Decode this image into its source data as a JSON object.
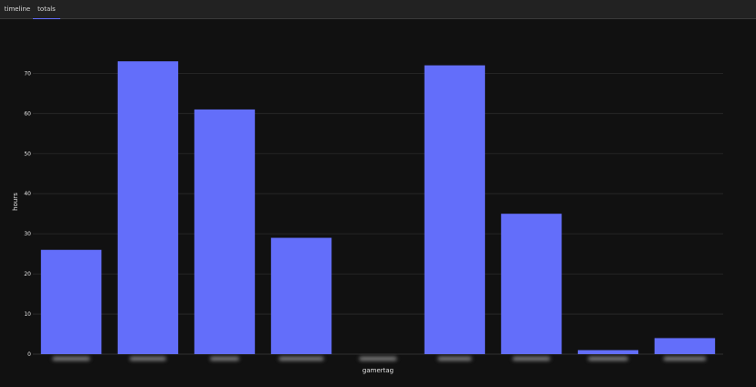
{
  "tabs": [
    {
      "label": "timeline",
      "active": false
    },
    {
      "label": "totals",
      "active": true
    }
  ],
  "colors": {
    "bar": "#636efa",
    "grid": "#2b2b2b",
    "background": "#111111",
    "tab_active_underline": "#636efa"
  },
  "chart_data": {
    "type": "bar",
    "title": "",
    "xlabel": "gamertag",
    "ylabel": "hours",
    "categories_obscured": true,
    "values": [
      26,
      73,
      61,
      29,
      0,
      72,
      35,
      1,
      4
    ],
    "ylim": [
      0,
      76
    ],
    "yticks": [
      0,
      10,
      20,
      30,
      40,
      50,
      60,
      70
    ],
    "grid": true,
    "legend": "none"
  }
}
